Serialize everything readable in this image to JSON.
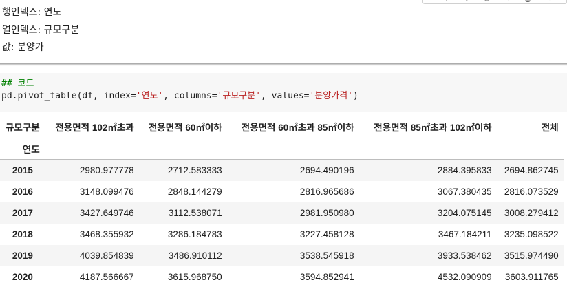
{
  "toolbar": {
    "items": [
      "↑",
      "↓",
      "⧉",
      "✎",
      "🗑",
      "⋮"
    ]
  },
  "markdown": {
    "lines": [
      "행인덱스: 연도",
      "열인덱스: 규모구분",
      "값: 분양가"
    ]
  },
  "code": {
    "comment": "## 코드",
    "tokens": [
      {
        "t": "pd.pivot_table(df, index=",
        "k": "plain"
      },
      {
        "t": "'연도'",
        "k": "str"
      },
      {
        "t": ", columns=",
        "k": "plain"
      },
      {
        "t": "'규모구분'",
        "k": "str"
      },
      {
        "t": ", values=",
        "k": "plain"
      },
      {
        "t": "'분양가격'",
        "k": "str"
      },
      {
        "t": ")",
        "k": "plain"
      }
    ]
  },
  "table": {
    "columns_label": "규모구분",
    "index_label": "연도",
    "columns": [
      "전용면적 102㎡초과",
      "전용면적 60㎡이하",
      "전용면적 60㎡초과 85㎡이하",
      "전용면적 85㎡초과 102㎡이하",
      "전체"
    ],
    "rows": [
      {
        "year": "2015",
        "values": [
          "2980.977778",
          "2712.583333",
          "2694.490196",
          "2884.395833",
          "2694.862745"
        ]
      },
      {
        "year": "2016",
        "values": [
          "3148.099476",
          "2848.144279",
          "2816.965686",
          "3067.380435",
          "2816.073529"
        ]
      },
      {
        "year": "2017",
        "values": [
          "3427.649746",
          "3112.538071",
          "2981.950980",
          "3204.075145",
          "3008.279412"
        ]
      },
      {
        "year": "2018",
        "values": [
          "3468.355932",
          "3286.184783",
          "3227.458128",
          "3467.184211",
          "3235.098522"
        ]
      },
      {
        "year": "2019",
        "values": [
          "4039.854839",
          "3486.910112",
          "3538.545918",
          "3933.538462",
          "3515.974490"
        ]
      },
      {
        "year": "2020",
        "values": [
          "4187.566667",
          "3615.968750",
          "3594.852941",
          "4532.090909",
          "3603.911765"
        ]
      }
    ]
  }
}
